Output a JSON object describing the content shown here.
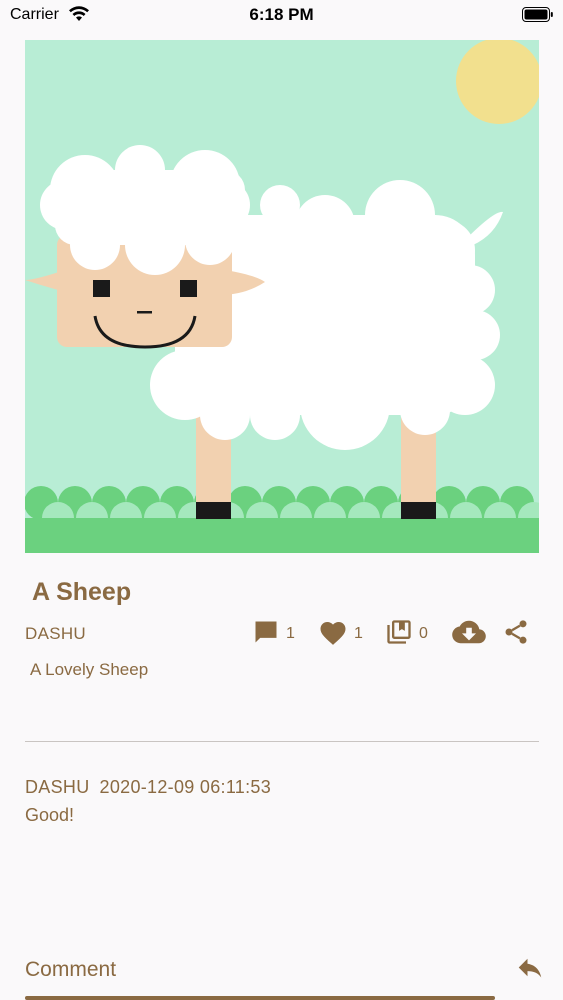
{
  "status_bar": {
    "carrier": "Carrier",
    "time": "6:18 PM"
  },
  "post": {
    "title": "A Sheep",
    "author": "DASHU",
    "description": "A Lovely Sheep",
    "stats": {
      "comments": "1",
      "likes": "1",
      "collections": "0"
    }
  },
  "comments": [
    {
      "user": "DASHU",
      "date": "2020-12-09 06:11:53",
      "text": "Good!"
    }
  ],
  "comment_input": {
    "placeholder": "Comment"
  },
  "colors": {
    "accent": "#8a6a42",
    "background": "#faf9fa",
    "sky": "#b8edd5",
    "grass": "#6bd17f",
    "sun": "#f2e08e",
    "sheep_face": "#f2d1b0"
  },
  "icons": {
    "comment": "chat-bubble-icon",
    "like": "heart-icon",
    "collect": "collection-icon",
    "download": "cloud-download-icon",
    "share": "share-icon",
    "send": "reply-icon"
  }
}
